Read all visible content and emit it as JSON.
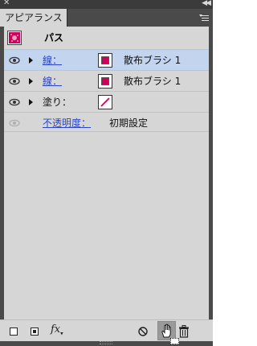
{
  "panel": {
    "tab_label": "アピアランス"
  },
  "header": {
    "title": "パス"
  },
  "rows": [
    {
      "label": "線：",
      "value": "散布ブラシ 1",
      "selected": true,
      "kind": "stroke"
    },
    {
      "label": "線：",
      "value": "散布ブラシ 1",
      "selected": false,
      "kind": "stroke"
    },
    {
      "label": "塗り：",
      "value": "",
      "selected": false,
      "kind": "fill-none"
    }
  ],
  "opacity": {
    "label": "不透明度：",
    "value": "初期設定"
  },
  "toolbar": {
    "fx_label": "fx"
  },
  "colors": {
    "swatch": "#d1005c",
    "selection": "#c3d4ef",
    "link": "#2a46c8",
    "panel_bg": "#d6d6d6",
    "chrome": "#4a4a4a"
  },
  "icons": [
    "close-icon",
    "collapse-icon",
    "panel-menu-icon",
    "path-thumbnail-icon",
    "eye-icon",
    "expand-triangle-icon",
    "color-swatch-icon",
    "none-swatch-icon",
    "new-stroke-icon",
    "new-fill-icon",
    "fx-icon",
    "clear-appearance-icon",
    "duplicate-item-icon",
    "delete-item-icon"
  ]
}
